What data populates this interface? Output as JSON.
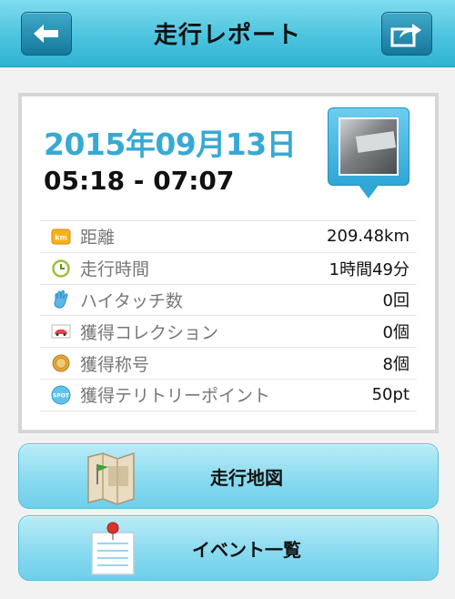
{
  "header": {
    "title": "走行レポート",
    "back_icon": "arrow-left-icon",
    "share_icon": "share-icon"
  },
  "report": {
    "date": "2015年09月13日",
    "time_range": "05:18 - 07:07",
    "stats": [
      {
        "icon": "km-icon",
        "label": "距離",
        "value": "209.48km"
      },
      {
        "icon": "clock-icon",
        "label": "走行時間",
        "value": "1時間49分"
      },
      {
        "icon": "hand-icon",
        "label": "ハイタッチ数",
        "value": "0回"
      },
      {
        "icon": "car-card-icon",
        "label": "獲得コレクション",
        "value": "0個"
      },
      {
        "icon": "medal-icon",
        "label": "獲得称号",
        "value": "8個"
      },
      {
        "icon": "spot-icon",
        "label": "獲得テリトリーポイント",
        "value": "50pt"
      }
    ],
    "km_badge": "km",
    "spot_badge": "SPOT"
  },
  "buttons": {
    "map_label": "走行地図",
    "events_label": "イベント一覧"
  },
  "colors": {
    "header": "#4cc4df",
    "date": "#38a9d3",
    "button": "#86d9ef"
  }
}
